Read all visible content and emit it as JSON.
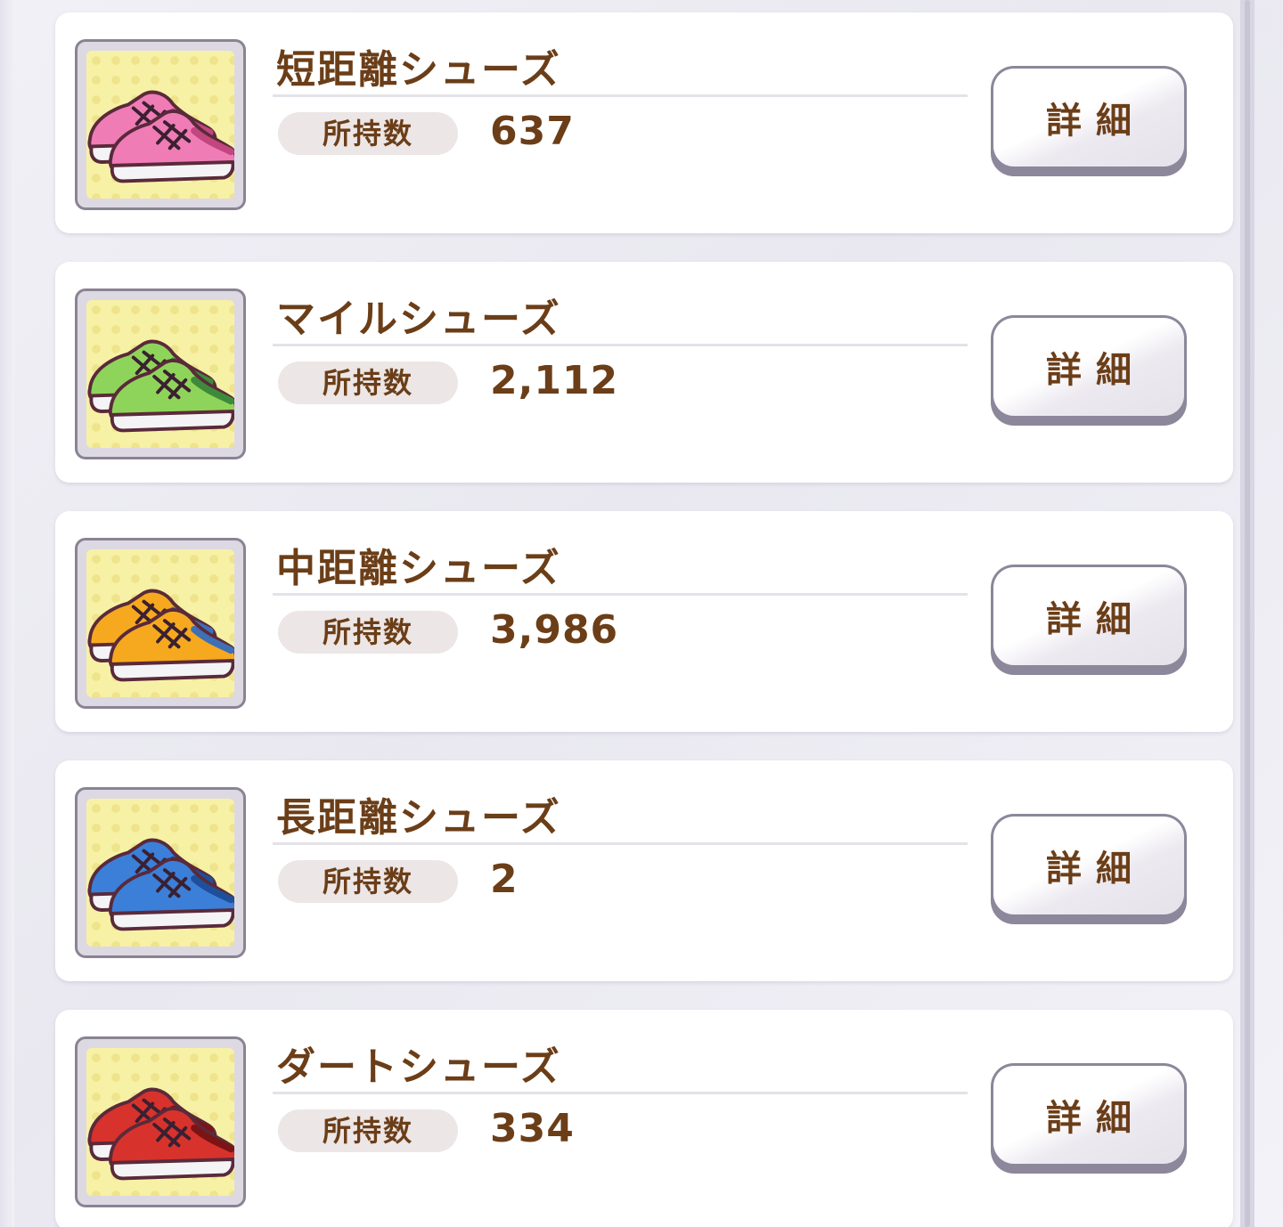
{
  "labels": {
    "count_label": "所持数",
    "detail_button": "詳細"
  },
  "items": [
    {
      "name": "短距離シューズ",
      "count": "637",
      "icon": "pink-sneakers-icon",
      "shoe_color": "#f07cb6",
      "shoe_dark": "#c2467f"
    },
    {
      "name": "マイルシューズ",
      "count": "2,112",
      "icon": "green-sneakers-icon",
      "shoe_color": "#8fd45a",
      "shoe_dark": "#3f8a3a"
    },
    {
      "name": "中距離シューズ",
      "count": "3,986",
      "icon": "orange-sneakers-icon",
      "shoe_color": "#f6a91e",
      "shoe_dark": "#3f6fb5"
    },
    {
      "name": "長距離シューズ",
      "count": "2",
      "icon": "blue-sneakers-icon",
      "shoe_color": "#3b7fd9",
      "shoe_dark": "#1f4f9a"
    },
    {
      "name": "ダートシューズ",
      "count": "334",
      "icon": "red-sneakers-icon",
      "shoe_color": "#d8322c",
      "shoe_dark": "#7c1416"
    }
  ]
}
